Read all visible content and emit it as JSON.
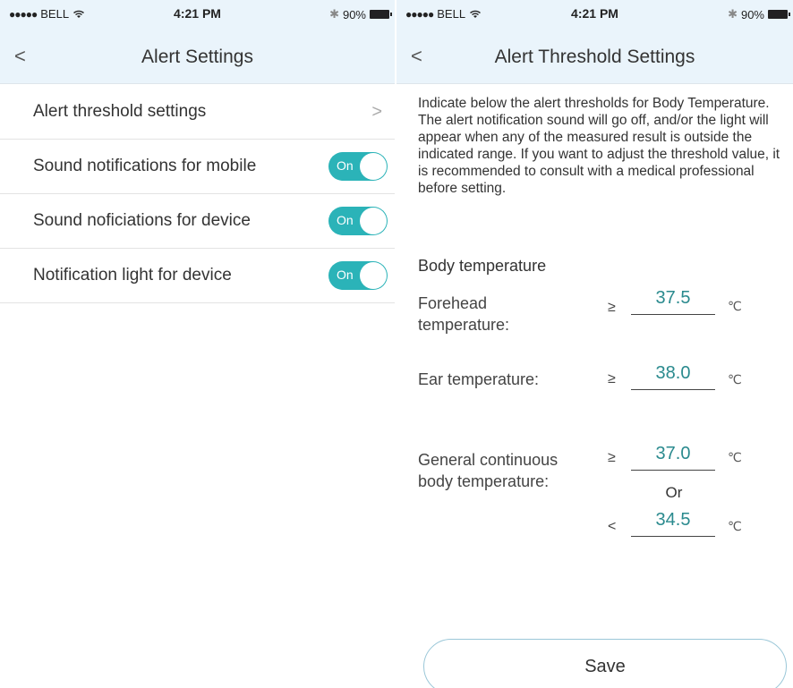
{
  "status_bar": {
    "signal_dots": "●●●●●",
    "carrier": "BELL",
    "time": "4:21 PM",
    "battery": "90%",
    "icons": [
      "wifi-icon",
      "bluetooth-icon",
      "battery-icon"
    ]
  },
  "left": {
    "back": "<",
    "title": "Alert Settings",
    "items": [
      {
        "label": "Alert threshold settings",
        "type": "link",
        "chevron": ">"
      },
      {
        "label": "Sound notifications for mobile",
        "type": "toggle",
        "state": "On"
      },
      {
        "label": "Sound noficiations for device",
        "type": "toggle",
        "state": "On"
      },
      {
        "label": "Notification light for device",
        "type": "toggle",
        "state": "On"
      }
    ]
  },
  "right": {
    "back": "<",
    "title": "Alert Threshold Settings",
    "description": "Indicate below the alert thresholds for Body Temperature. The alert notification sound will go off, and/or the light will appear when any of the measured result is outside the indicated range. If you want to adjust the threshold value, it is recommended to consult with a medical professional before setting.",
    "section_title": "Body temperature",
    "forehead": {
      "label": "Forehead temperature:",
      "op": "≥",
      "value": "37.5",
      "unit": "℃"
    },
    "ear": {
      "label": "Ear temperature:",
      "op": "≥",
      "value": "38.0",
      "unit": "℃"
    },
    "continuous": {
      "label": "General continuous body temperature:",
      "upper": {
        "op": "≥",
        "value": "37.0",
        "unit": "℃"
      },
      "or_text": "Or",
      "lower": {
        "op": "<",
        "value": "34.5",
        "unit": "℃"
      }
    },
    "save_label": "Save"
  },
  "colors": {
    "header_bg": "#eaf4fb",
    "toggle_on": "#2bb3b8",
    "value_text": "#2a8a8e",
    "save_border": "#9ac7d8"
  }
}
